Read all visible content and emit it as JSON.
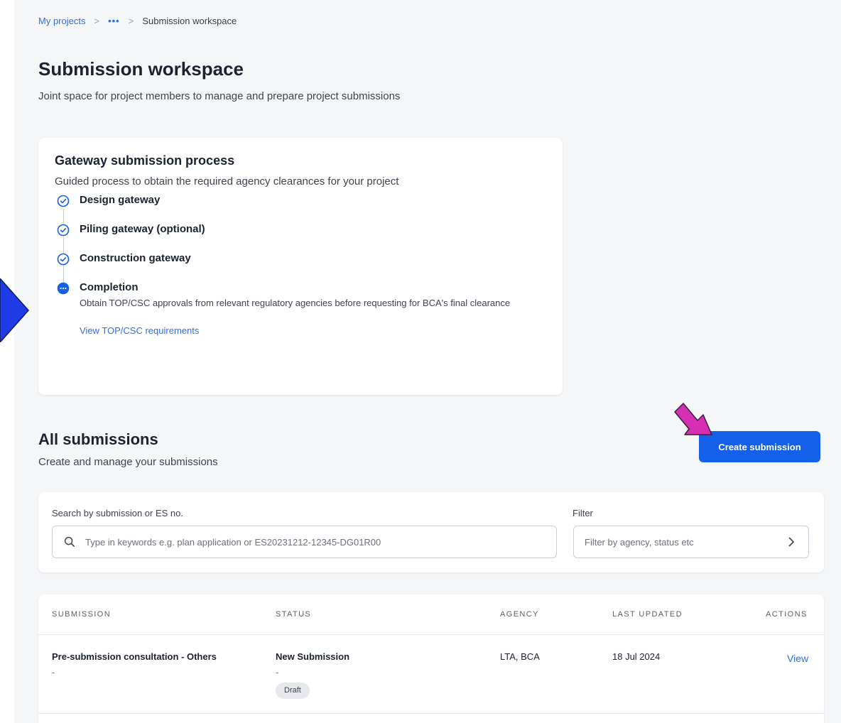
{
  "breadcrumb": {
    "root": "My projects",
    "sep1": ">",
    "more": "•••",
    "sep2": ">",
    "current": "Submission workspace"
  },
  "page": {
    "title": "Submission workspace",
    "subtitle": "Joint space for project members to manage and prepare project submissions"
  },
  "gateway": {
    "title": "Gateway submission process",
    "subtitle": "Guided process to obtain the required agency clearances for your project",
    "steps": [
      {
        "label": "Design gateway",
        "state": "done"
      },
      {
        "label": "Piling gateway (optional)",
        "state": "done"
      },
      {
        "label": "Construction gateway",
        "state": "done"
      },
      {
        "label": "Completion",
        "state": "in-progress",
        "description": "Obtain TOP/CSC approvals from relevant regulatory agencies before requesting for BCA's final clearance",
        "link": "View TOP/CSC requirements"
      }
    ]
  },
  "submissions": {
    "title": "All submissions",
    "subtitle": "Create and manage your submissions",
    "create_label": "Create submission",
    "search_label": "Search by submission or ES no.",
    "search_placeholder": "Type in keywords e.g. plan application or ES20231212-12345-DG01R00",
    "filter_label": "Filter",
    "filter_placeholder": "Filter by agency, status etc",
    "columns": [
      "SUBMISSION",
      "STATUS",
      "AGENCY",
      "LAST UPDATED",
      "ACTIONS"
    ],
    "rows": [
      {
        "submission": "Pre-submission consultation - Others",
        "submission_sub": "-",
        "status": "New Submission",
        "status_sub": "-",
        "badge": "Draft",
        "agency": "LTA, BCA",
        "last_updated": "18 Jul 2024",
        "action": "View"
      }
    ]
  },
  "colors": {
    "primary": "#1460e8",
    "link": "#2f6fe4",
    "annotation_left": "#1f3be8",
    "annotation_pink": "#d62fb4"
  },
  "icons": {
    "step_done": "check-circle-icon",
    "step_current": "ellipsis-circle-icon",
    "search": "search-icon",
    "filter_chevron": "chevron-right-icon"
  }
}
